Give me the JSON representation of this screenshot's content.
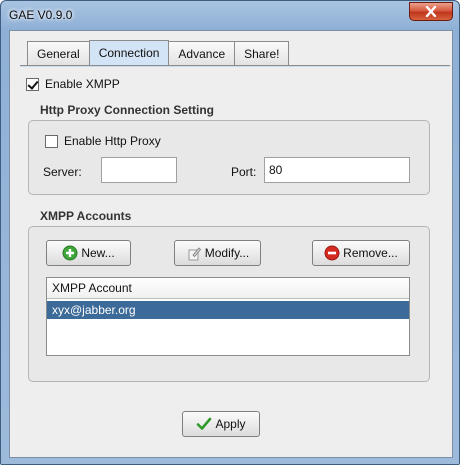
{
  "window": {
    "title": "GAE V0.9.0"
  },
  "tabs": [
    {
      "label": "General"
    },
    {
      "label": "Connection"
    },
    {
      "label": "Advance"
    },
    {
      "label": "Share!"
    }
  ],
  "enable_xmpp": {
    "label": "Enable XMPP",
    "checked": true
  },
  "proxy": {
    "section_title": "Http Proxy Connection Setting",
    "enable_label": "Enable Http Proxy",
    "enable_checked": false,
    "server_label": "Server:",
    "server_value": "",
    "port_label": "Port:",
    "port_value": "80"
  },
  "accounts": {
    "section_title": "XMPP Accounts",
    "new_label": "New...",
    "modify_label": "Modify...",
    "remove_label": "Remove...",
    "column_header": "XMPP Account",
    "rows": [
      "xyx@jabber.org"
    ]
  },
  "apply_label": "Apply",
  "colors": {
    "selection": "#3c6a99",
    "tab_active": "#d2e4f5",
    "close_button": "#c0361e"
  }
}
